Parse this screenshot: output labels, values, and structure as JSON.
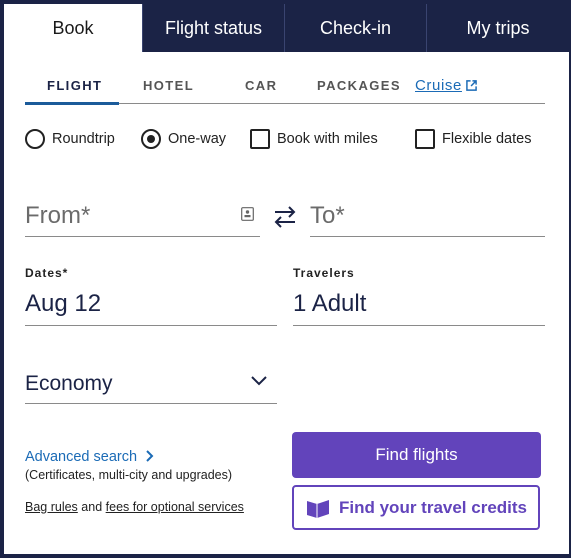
{
  "tabs": [
    {
      "label": "Book"
    },
    {
      "label": "Flight status"
    },
    {
      "label": "Check-in"
    },
    {
      "label": "My trips"
    }
  ],
  "subtabs": {
    "flight": "FLIGHT",
    "hotel": "HOTEL",
    "car": "CAR",
    "packages": "PACKAGES",
    "cruise": "Cruise"
  },
  "options": {
    "roundtrip": "Roundtrip",
    "oneway": "One-way",
    "miles": "Book with miles",
    "flexible": "Flexible dates"
  },
  "from": {
    "placeholder": "From*"
  },
  "to": {
    "placeholder": "To*"
  },
  "dates": {
    "label": "Dates*",
    "value": "Aug 12"
  },
  "travelers": {
    "label": "Travelers",
    "value": "1 Adult"
  },
  "cabin": {
    "value": "Economy"
  },
  "advanced": {
    "label": "Advanced search",
    "sub": "(Certificates, multi-city and upgrades)"
  },
  "bag": {
    "link1": "Bag rules",
    "and": "and",
    "link2": "fees for optional services"
  },
  "buttons": {
    "find_flights": "Find flights",
    "travel_credits": "Find your travel credits"
  },
  "colors": {
    "navy": "#1b2346",
    "purple": "#6244bb",
    "link": "#1b6bb6"
  }
}
